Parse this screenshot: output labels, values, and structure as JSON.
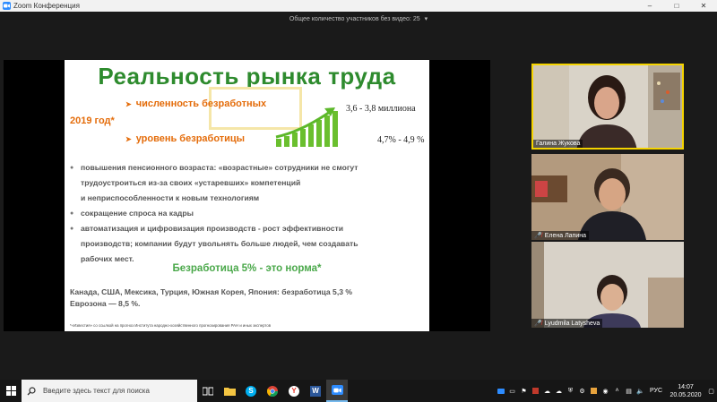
{
  "window": {
    "title": "Zoom Конференция",
    "minimize": "–",
    "maximize": "□",
    "close": "✕"
  },
  "participants_bar": {
    "text": "Общее количество участников без видео: 25",
    "chevron": "▾"
  },
  "slide": {
    "title": "Реальность рынка труда",
    "year": "2019 год*",
    "stat1_label": "численность безработных",
    "stat1_value": "3,6 - 3,8 миллиона",
    "stat2_label": "уровень безработицы",
    "stat2_value": "4,7% - 4,9 %",
    "bullets": [
      {
        "lines": [
          "повышения пенсионного возраста: «возрастные» сотрудники не смогут",
          "трудоустроиться из-за своих «устаревших» компетенций",
          "и неприспособленности к новым технологиям"
        ]
      },
      {
        "lines": [
          "сокращение спроса на кадры"
        ]
      },
      {
        "lines": [
          "автоматизация и цифровизация производств - рост эффективности",
          "производств; компании будут увольнять больше людей, чем создавать",
          "рабочих мест."
        ]
      }
    ],
    "norm": "Безработица 5% - это норма*",
    "countries_line1": "Канада, США, Мексика, Турция, Южная Корея, Япония:  безработица 5,3 %",
    "countries_line2": "Еврозона — 8,5 %.",
    "footnote": "*«Известия» со ссылкой на прогноз Института народно-хозяйственного прогнозирования РАН и иных экспертов",
    "colors": {
      "title": "#2e8b2e",
      "accent": "#e46c0a",
      "bars": "#6abf2e"
    }
  },
  "videos": [
    {
      "name": "Галина Жукова",
      "muted": false
    },
    {
      "name": "Елена Лапина",
      "muted": true
    },
    {
      "name": "Lyudmila Latysheva",
      "muted": true
    }
  ],
  "taskbar": {
    "search_placeholder": "Введите здесь текст для поиска",
    "icons": [
      "task-view-icon",
      "file-explorer-icon",
      "skype-icon",
      "chrome-icon",
      "yandex-icon",
      "word-icon",
      "zoom-icon"
    ],
    "word_letter": "W",
    "yandex_letter": "Y",
    "skype_letter": "S",
    "language": "РУС",
    "time": "14:07",
    "date": "20.05.2020"
  }
}
